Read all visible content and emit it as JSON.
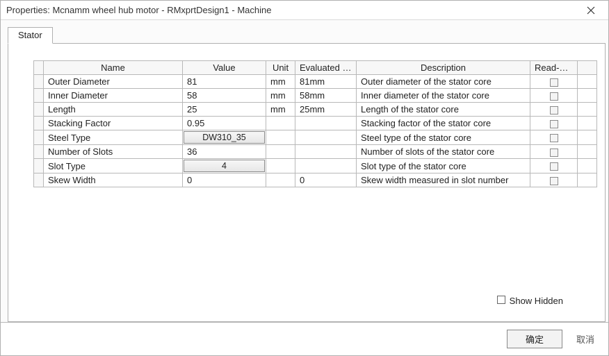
{
  "window": {
    "title": "Properties: Mcnamm wheel hub motor - RMxprtDesign1 - Machine"
  },
  "tabs": [
    {
      "label": "Stator"
    }
  ],
  "grid": {
    "columns": {
      "name": "Name",
      "value": "Value",
      "unit": "Unit",
      "evaluated": "Evaluated Va...",
      "description": "Description",
      "readonly": "Read-only"
    },
    "rows": [
      {
        "name": "Outer Diameter",
        "value": "81",
        "value_kind": "text",
        "unit": "mm",
        "evaluated": "81mm",
        "description": "Outer diameter of the stator core",
        "readonly": false
      },
      {
        "name": "Inner Diameter",
        "value": "58",
        "value_kind": "text",
        "unit": "mm",
        "evaluated": "58mm",
        "description": "Inner diameter of the stator core",
        "readonly": false
      },
      {
        "name": "Length",
        "value": "25",
        "value_kind": "text",
        "unit": "mm",
        "evaluated": "25mm",
        "description": "Length of the stator core",
        "readonly": false
      },
      {
        "name": "Stacking Factor",
        "value": "0.95",
        "value_kind": "text",
        "unit": "",
        "evaluated": "",
        "description": "Stacking factor of the stator core",
        "readonly": false
      },
      {
        "name": "Steel Type",
        "value": "DW310_35",
        "value_kind": "button",
        "unit": "",
        "evaluated": "",
        "description": "Steel type of the stator core",
        "readonly": false
      },
      {
        "name": "Number of Slots",
        "value": "36",
        "value_kind": "text",
        "unit": "",
        "evaluated": "",
        "description": "Number of slots of the stator core",
        "readonly": false
      },
      {
        "name": "Slot Type",
        "value": "4",
        "value_kind": "button",
        "unit": "",
        "evaluated": "",
        "description": "Slot type of the stator core",
        "readonly": false
      },
      {
        "name": "Skew Width",
        "value": "0",
        "value_kind": "text",
        "unit": "",
        "evaluated": "0",
        "description": "Skew width measured in slot number",
        "readonly": false
      }
    ]
  },
  "show_hidden": {
    "label": "Show Hidden",
    "checked": false
  },
  "footer": {
    "ok": "确定",
    "cancel": "取消"
  }
}
